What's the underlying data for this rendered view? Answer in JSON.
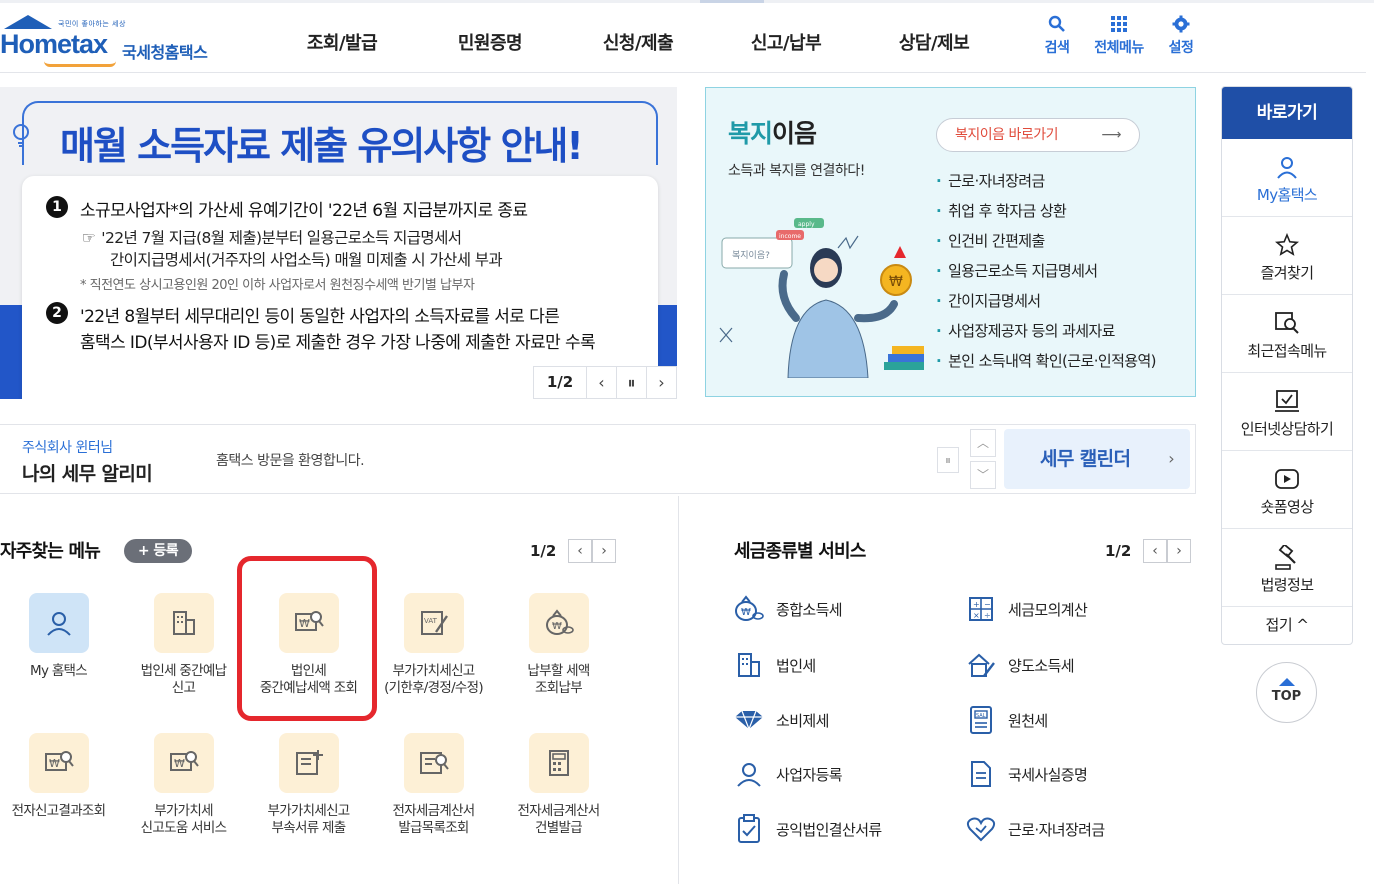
{
  "logo": {
    "tagline": "국민이 좋아하는 세상",
    "main": "Hometax",
    "korean": "국세청홈택스"
  },
  "gnb": [
    "조회/발급",
    "민원증명",
    "신청/제출",
    "신고/납부",
    "상담/제보"
  ],
  "util": [
    {
      "label": "검색",
      "icon": "search-icon"
    },
    {
      "label": "전체메뉴",
      "icon": "grid-icon"
    },
    {
      "label": "설정",
      "icon": "gear-icon"
    }
  ],
  "banner": {
    "title": "매월 소득자료 제출 유의사항 안내!",
    "item1_num": "1",
    "item1": "소규모사업자*의 가산세 유예기간이 '22년 6월 지급분까지로 종료",
    "item1_sub1": "'22년 7월 지급(8월 제출)분부터 일용근로소득 지급명세서",
    "item1_sub2": "간이지급명세서(거주자의 사업소득) 매월 미제출 시 가산세 부과",
    "note": "* 직전연도 상시고용인원 20인 이하 사업자로서 원천징수세액 반기별 납부자",
    "item2_num": "2",
    "item2_l1": "'22년 8월부터 세무대리인 등이 동일한 사업자의 소득자료를 서로 다른",
    "item2_l2": "홈택스 ID(부서사용자 ID 등)로 제출한 경우 가장 나중에 제출한 자료만 수록",
    "pager": "1/2",
    "prev": "‹",
    "pause": "⏸",
    "next": "›"
  },
  "welfare": {
    "title_a": "복지",
    "title_b": "이음",
    "sub": "소득과 복지를 연결하다!",
    "link": "복지이음 바로가기",
    "items": [
      "근로·자녀장려금",
      "취업 후 학자금 상환",
      "인건비 간편제출",
      "일용근로소득 지급명세서",
      "간이지급명세서",
      "사업장제공자 등의 과세자료",
      "본인 소득내역 확인(근로·인적용역)"
    ],
    "illus_text1": "복지이음?",
    "illus_text2": "income",
    "illus_text3": "apply"
  },
  "alarm": {
    "company": "주식회사 윈터님",
    "title": "나의 세무 알리미",
    "message": "홈택스 방문을 환영합니다.",
    "calendar": "세무 캘린더"
  },
  "favorites": {
    "title": "자주찾는 메뉴",
    "register": "+ 등록",
    "pager": "1/2",
    "items": [
      {
        "l1": "My 홈택스",
        "l2": "",
        "icon": "person-icon"
      },
      {
        "l1": "법인세 중간예납",
        "l2": "신고",
        "icon": "building-icon"
      },
      {
        "l1": "법인세",
        "l2": "중간예납세액 조회",
        "icon": "won-search-icon"
      },
      {
        "l1": "부가가치세신고",
        "l2": "(기한후/경정/수정)",
        "icon": "vat-doc-icon"
      },
      {
        "l1": "납부할 세액",
        "l2": "조회납부",
        "icon": "money-bag-icon"
      },
      {
        "l1": "전자신고결과조회",
        "l2": "",
        "icon": "won-search-icon"
      },
      {
        "l1": "부가가치세",
        "l2": "신고도움 서비스",
        "icon": "won-search-icon"
      },
      {
        "l1": "부가가치세신고",
        "l2": "부속서류 제출",
        "icon": "doc-plus-icon"
      },
      {
        "l1": "전자세금계산서",
        "l2": "발급목록조회",
        "icon": "doc-search-icon"
      },
      {
        "l1": "전자세금계산서",
        "l2": "건별발급",
        "icon": "calculator-icon"
      }
    ]
  },
  "tax_services": {
    "title": "세금종류별 서비스",
    "pager": "1/2",
    "items": [
      {
        "label": "종합소득세",
        "icon": "money-bag-icon"
      },
      {
        "label": "세금모의계산",
        "icon": "calculator-icon"
      },
      {
        "label": "법인세",
        "icon": "building-icon"
      },
      {
        "label": "양도소득세",
        "icon": "house-doc-icon"
      },
      {
        "label": "소비제세",
        "icon": "gem-icon"
      },
      {
        "label": "원천세",
        "icon": "salary-doc-icon"
      },
      {
        "label": "사업자등록",
        "icon": "person-icon"
      },
      {
        "label": "국세사실증명",
        "icon": "document-icon"
      },
      {
        "label": "공익법인결산서류",
        "icon": "clipboard-check-icon"
      },
      {
        "label": "근로·자녀장려금",
        "icon": "heart-icon"
      }
    ]
  },
  "quick": {
    "header": "바로가기",
    "items": [
      {
        "label": "My홈택스",
        "icon": "person-icon"
      },
      {
        "label": "즐겨찾기",
        "icon": "star-icon"
      },
      {
        "label": "최근접속메뉴",
        "icon": "recent-search-icon"
      },
      {
        "label": "인터넷상담하기",
        "icon": "chat-check-icon"
      },
      {
        "label": "숏폼영상",
        "icon": "play-icon"
      },
      {
        "label": "법령정보",
        "icon": "gavel-icon"
      }
    ],
    "fold": "접기 ^",
    "top": "TOP"
  }
}
